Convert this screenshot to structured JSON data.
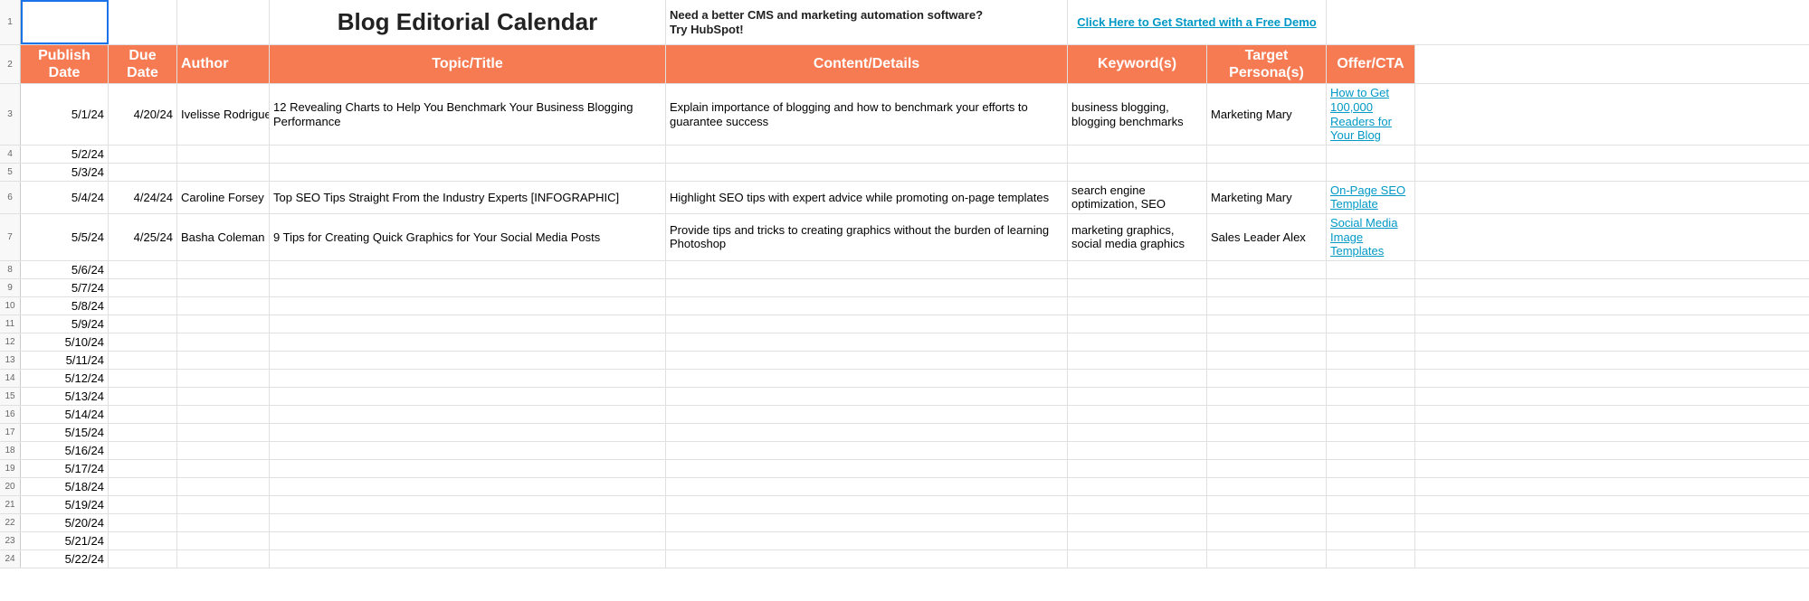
{
  "row1": {
    "title": "Blog Editorial Calendar",
    "cms_line1": "Need a better CMS and marketing automation software?",
    "cms_line2": "Try HubSpot!",
    "demo_link": "Click Here to Get Started with a Free Demo"
  },
  "headers": {
    "publish": "Publish Date",
    "due": "Due Date",
    "author": "Author",
    "topic": "Topic/Title",
    "content": "Content/Details",
    "keywords": "Keyword(s)",
    "persona": "Target Persona(s)",
    "offer": "Offer/CTA"
  },
  "rows": [
    {
      "n": "3",
      "publish": "5/1/24",
      "due": "4/20/24",
      "author": "Ivelisse Rodriguez",
      "topic": "12 Revealing Charts to Help You Benchmark Your Business Blogging Performance",
      "content": "Explain importance of blogging and how to benchmark your efforts to guarantee success",
      "keywords": "business blogging, blogging benchmarks",
      "persona": "Marketing Mary",
      "offer": "How to Get 100,000 Readers for Your Blog",
      "offer_link": true
    },
    {
      "n": "4",
      "publish": "5/2/24",
      "due": "",
      "author": "",
      "topic": "",
      "content": "",
      "keywords": "",
      "persona": "",
      "offer": ""
    },
    {
      "n": "5",
      "publish": "5/3/24",
      "due": "",
      "author": "",
      "topic": "",
      "content": "",
      "keywords": "",
      "persona": "",
      "offer": ""
    },
    {
      "n": "6",
      "publish": "5/4/24",
      "due": "4/24/24",
      "author": "Caroline Forsey",
      "topic": "Top SEO Tips Straight From the Industry Experts [INFOGRAPHIC]",
      "content": "Highlight SEO tips with expert advice while promoting on-page templates",
      "keywords": "search engine optimization, SEO",
      "persona": "Marketing Mary",
      "offer": "On-Page SEO Template",
      "offer_link": true
    },
    {
      "n": "7",
      "publish": "5/5/24",
      "due": "4/25/24",
      "author": "Basha Coleman",
      "topic": "9 Tips for Creating Quick Graphics for Your Social Media Posts",
      "content": "Provide tips and tricks to creating graphics without the burden of learning Photoshop",
      "keywords": "marketing graphics, social media graphics",
      "persona": "Sales Leader Alex",
      "offer": "Social Media Image Templates",
      "offer_link": true
    },
    {
      "n": "8",
      "publish": "5/6/24"
    },
    {
      "n": "9",
      "publish": "5/7/24"
    },
    {
      "n": "10",
      "publish": "5/8/24"
    },
    {
      "n": "11",
      "publish": "5/9/24"
    },
    {
      "n": "12",
      "publish": "5/10/24"
    },
    {
      "n": "13",
      "publish": "5/11/24"
    },
    {
      "n": "14",
      "publish": "5/12/24"
    },
    {
      "n": "15",
      "publish": "5/13/24"
    },
    {
      "n": "16",
      "publish": "5/14/24"
    },
    {
      "n": "17",
      "publish": "5/15/24"
    },
    {
      "n": "18",
      "publish": "5/16/24"
    },
    {
      "n": "19",
      "publish": "5/17/24"
    },
    {
      "n": "20",
      "publish": "5/18/24"
    },
    {
      "n": "21",
      "publish": "5/19/24"
    },
    {
      "n": "22",
      "publish": "5/20/24"
    },
    {
      "n": "23",
      "publish": "5/21/24"
    },
    {
      "n": "24",
      "publish": "5/22/24"
    }
  ]
}
